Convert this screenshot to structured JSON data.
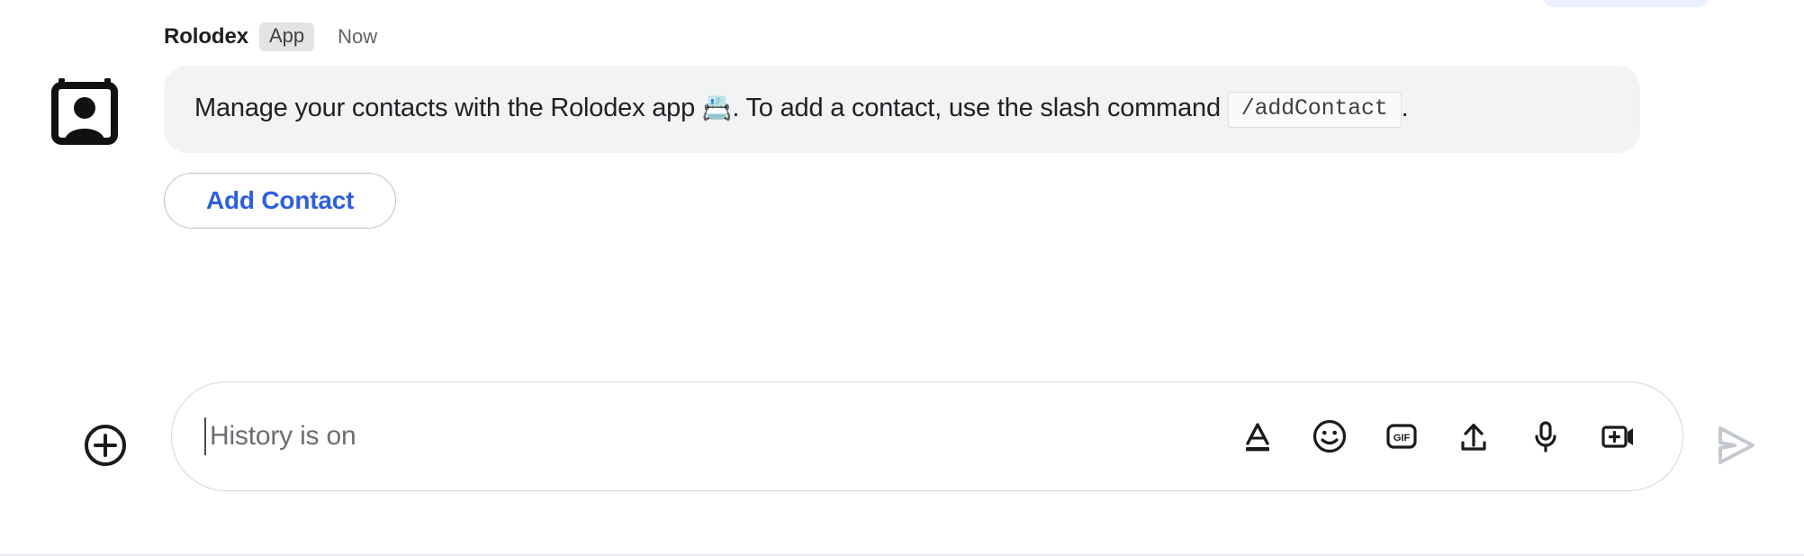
{
  "top_chip": {
    "name": "clipped-pill",
    "color": "#eaf0fd"
  },
  "message": {
    "sender": "Rolodex",
    "badge": "App",
    "timestamp": "Now",
    "avatar_icon": "contact-card-icon",
    "body": {
      "part1": "Manage your contacts with the Rolodex app ",
      "emoji": "📇",
      "part2": ". To add a contact, use the slash command ",
      "code": "/addContact",
      "part3": "."
    },
    "action_button": "Add Contact"
  },
  "composer": {
    "add_icon": "plus-circle-icon",
    "placeholder": "History is on",
    "value": "",
    "tools": [
      {
        "icon": "format-text-icon",
        "label": "Format"
      },
      {
        "icon": "emoji-smiley-icon",
        "label": "Emoji"
      },
      {
        "icon": "gif-icon",
        "label": "GIF"
      },
      {
        "icon": "upload-icon",
        "label": "Upload file"
      },
      {
        "icon": "microphone-icon",
        "label": "Voice message"
      },
      {
        "icon": "add-video-icon",
        "label": "Video meeting"
      }
    ],
    "send": {
      "icon": "send-arrow-icon",
      "label": "Send",
      "enabled": false,
      "color": "#c3c8cf"
    }
  },
  "colors": {
    "accent_blue": "#2c5fe0",
    "bubble_bg": "#f1f3f4",
    "badge_bg": "#e4e4e4",
    "text_primary": "#202124",
    "text_secondary": "#5f6368"
  }
}
